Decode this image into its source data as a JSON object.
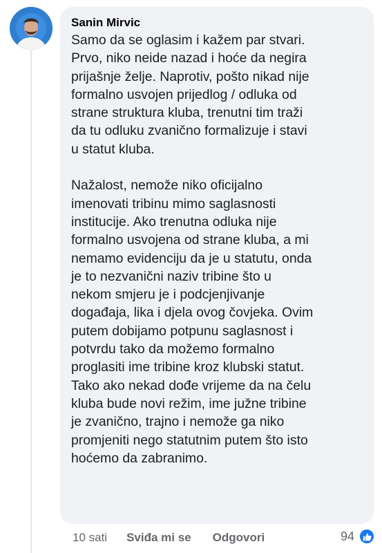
{
  "comment": {
    "author": "Sanin Mirvic",
    "paragraph1": [
      "Samo da se oglasim i kažem par stvari.",
      "Prvo, niko neide nazad i hoće da negira",
      "prijašnje želje. Naprotiv, pošto nikad nije",
      "formalno usvojen prijedlog / odluka od",
      "strane struktura kluba, trenutni tim traži",
      "da tu odluku zvanično formalizuje i stavi",
      "u statut kluba."
    ],
    "paragraph2": [
      "Nažalost, nemože niko oficijalno",
      "imenovati tribinu mimo saglasnosti",
      "institucije. Ako trenutna odluka nije",
      "formalno usvojena od strane kluba, a mi",
      "nemamo evidenciju da je u statutu, onda",
      "je to nezvanični naziv tribine što u",
      "nekom smjeru je i podcjenjivanje",
      "događaja, lika i djela ovog čovjeka. Ovim",
      "putem dobijamo potpunu saglasnost i",
      "potvrdu tako da možemo formalno",
      "proglasiti ime tribine kroz klubski statut.",
      "Tako ako nekad dođe vrijeme da na čelu",
      "kluba bude novi režim, ime južne tribine",
      "je zvanično, trajno i nemože ga niko",
      "promjeniti nego statutnim putem što isto",
      "hoćemo da zabranimo."
    ]
  },
  "actions": {
    "time": "10 sati",
    "like_label": "Sviđa mi se",
    "reply_label": "Odgovori"
  },
  "reactions": {
    "count": "94",
    "icon": "thumbs-up-icon",
    "color": "#1877f2"
  }
}
